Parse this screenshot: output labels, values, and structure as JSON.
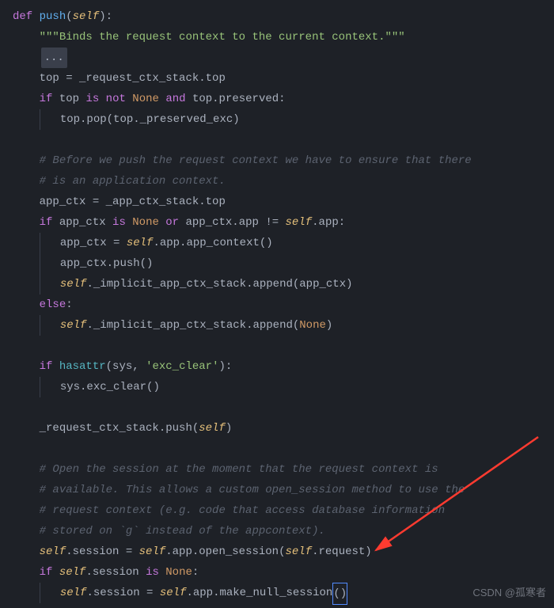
{
  "code": {
    "def_kw": "def",
    "fn_name": "push",
    "self_param": "self",
    "docstring": "\"\"\"Binds the request context to the current context.\"\"\"",
    "collapsed": "...",
    "l_top_assign": "top = _request_ctx_stack.top",
    "l_if_top": {
      "if": "if",
      "var": "top",
      "is": "is",
      "not": "not",
      "none": "None",
      "and": "and",
      "expr": "top.preserved:"
    },
    "l_top_pop": "top.pop(top._preserved_exc)",
    "cmt_before1": "# Before we push the request context we have to ensure that there",
    "cmt_before2": "# is an application context.",
    "l_appctx_assign": "app_ctx = _app_ctx_stack.top",
    "l_if_appctx": {
      "if": "if",
      "var": "app_ctx",
      "is": "is",
      "none": "None",
      "or": "or",
      "cmp": "app_ctx.app != ",
      "self": "self",
      "tail": ".app:"
    },
    "l_appctx_new": {
      "lhs": "app_ctx = ",
      "self": "self",
      "tail": ".app.app_context()"
    },
    "l_appctx_push": "app_ctx.push()",
    "l_impl_append": {
      "self": "self",
      "mid": "._implicit_app_ctx_stack.append(app_ctx)"
    },
    "else_kw": "else",
    "l_impl_append_none": {
      "self": "self",
      "mid": "._implicit_app_ctx_stack.append(",
      "none": "None",
      "tail": ")"
    },
    "l_if_hasattr": {
      "if": "if",
      "fn": "hasattr",
      "args_pre": "(sys, ",
      "str": "'exc_clear'",
      "args_post": "):"
    },
    "l_exc_clear": "sys.exc_clear()",
    "l_stack_push": {
      "pre": "_request_ctx_stack.push(",
      "self": "self",
      "post": ")"
    },
    "cmt_open1": "# Open the session at the moment that the request context is",
    "cmt_open2": "# available. This allows a custom open_session method to use the",
    "cmt_open3": "# request context (e.g. code that access database information",
    "cmt_open4": "# stored on `g` instead of the appcontext).",
    "l_sess_assign": {
      "self1": "self",
      "mid1": ".session = ",
      "self2": "self",
      "mid2": ".app.open_session(",
      "self3": "self",
      "tail": ".request)"
    },
    "l_if_sess": {
      "if": "if",
      "self": "self",
      "mid": ".session ",
      "is": "is",
      "none": "None",
      "colon": ":"
    },
    "l_sess_null": {
      "self1": "self",
      "mid1": ".session = ",
      "self2": "self",
      "mid2": ".app.make_null_session",
      "paren": "()"
    }
  },
  "watermark": "CSDN @孤寒者"
}
